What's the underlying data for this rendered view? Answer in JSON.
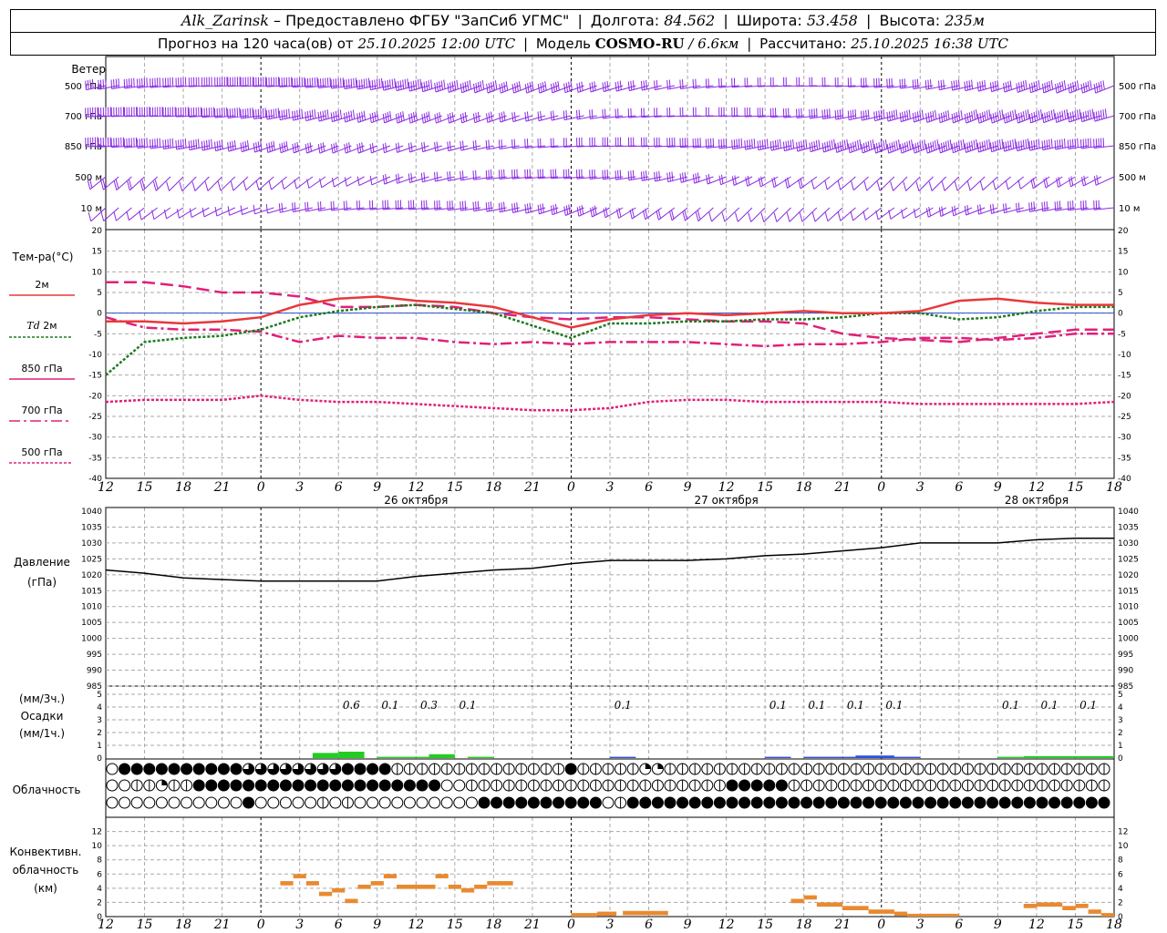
{
  "header": {
    "station": "Alk_Zarinsk",
    "dash": "–",
    "provider": "Предоставлено ФГБУ \"ЗапСиб УГМС\"",
    "lon_label": "Долгота:",
    "lon_value": "84.562",
    "lat_label": "Широта:",
    "lat_value": "53.458",
    "alt_label": "Высота:",
    "alt_value": "235м",
    "forecast_label": "Прогноз на 120 часа(ов) от",
    "forecast_from": "25.10.2025 12:00 UTC",
    "model_label": "Модель",
    "model_name": "COSMO-RU",
    "model_res": "/ 6.6км",
    "calc_label": "Рассчитано:",
    "calc_time": "25.10.2025 16:38 UTC"
  },
  "labels": {
    "wind": "Ветер",
    "temp": "Тем-ра(°C)",
    "t2m": "2м",
    "td": "Td",
    "td2m": "2м",
    "t850": "850 гПа",
    "t700": "700 гПа",
    "t500": "500 гПа",
    "pressure": "Давление",
    "pressure_unit": "(гПа)",
    "precip_unit3": "(мм/3ч.)",
    "precip": "Осадки",
    "precip_unit1": "(мм/1ч.)",
    "cloud": "Облачность",
    "conv1": "Конвективн.",
    "conv2": "облачность",
    "conv3": "(км)"
  },
  "chart_data": {
    "hours": [
      "12",
      "15",
      "18",
      "21",
      "0",
      "3",
      "6",
      "9",
      "12",
      "15",
      "18",
      "21",
      "0",
      "3",
      "6",
      "9",
      "12",
      "15",
      "18",
      "21",
      "0",
      "3",
      "6",
      "9",
      "12",
      "15",
      "18"
    ],
    "dates": [
      "26 октября",
      "27 октября",
      "28 октября"
    ],
    "colors": {
      "t2m": "#e8383a",
      "td": "#1f7a1f",
      "t850": "#e0207a",
      "pressure": "#000000",
      "precip": "#22cc22",
      "precip_blue": "#3050dd",
      "conv": "#e88a30",
      "wind": "#8a2be2",
      "grid": "#aaaaaa"
    },
    "wind": {
      "levels": [
        "500 гПа",
        "700 гПа",
        "850 гПа",
        "500 м",
        "10  м"
      ]
    },
    "temperature": {
      "type": "line",
      "ylim": [
        -40,
        20
      ],
      "yticks": [
        20,
        15,
        10,
        5,
        0,
        -5,
        -10,
        -15,
        -20,
        -25,
        -30,
        -35,
        -40
      ],
      "t2m": [
        -2,
        -2,
        -2.5,
        -2,
        -1,
        2,
        3.5,
        4,
        3,
        2.5,
        1.5,
        -1,
        -3.5,
        -1.5,
        -0.5,
        0,
        -0.5,
        0,
        0.5,
        0,
        0,
        0.5,
        3,
        3.5,
        2.5,
        2,
        2
      ],
      "td2m": [
        -15,
        -7,
        -6,
        -5.5,
        -4,
        -1,
        0.5,
        1.5,
        2,
        1,
        0,
        -3,
        -6,
        -2.5,
        -2.5,
        -2,
        -2,
        -1.5,
        -1.5,
        -1,
        0,
        0,
        -1.5,
        -1,
        0.5,
        1.5,
        1.5
      ],
      "t850": [
        7.5,
        7.5,
        6.5,
        5,
        5,
        4,
        1.5,
        1.5,
        2,
        1.5,
        0,
        -1,
        -1.5,
        -1,
        -1,
        -1.5,
        -2,
        -2,
        -2.5,
        -5,
        -6,
        -6.5,
        -7,
        -6,
        -5,
        -4,
        -4
      ],
      "t700": [
        -1,
        -3.5,
        -4,
        -4,
        -4.5,
        -7,
        -5.5,
        -6,
        -6,
        -7,
        -7.5,
        -7,
        -7.5,
        -7,
        -7,
        -7,
        -7.5,
        -8,
        -7.5,
        -7.5,
        -7,
        -6,
        -6,
        -6.5,
        -6,
        -5,
        -5
      ],
      "t500": [
        -21.5,
        -21,
        -21,
        -21,
        -20,
        -21,
        -21.5,
        -21.5,
        -22,
        -22.5,
        -23,
        -23.5,
        -23.5,
        -23,
        -21.5,
        -21,
        -21,
        -21.5,
        -21.5,
        -21.5,
        -21.5,
        -22,
        -22,
        -22,
        -22,
        -22,
        -21.5
      ]
    },
    "pressure": {
      "type": "line",
      "ylim": [
        985,
        1040
      ],
      "yticks": [
        1040,
        1035,
        1030,
        1025,
        1020,
        1015,
        1010,
        1005,
        1000,
        995,
        990,
        985
      ],
      "values": [
        1021.5,
        1020.5,
        1019,
        1018.5,
        1018,
        1018,
        1018,
        1018,
        1019.5,
        1020.5,
        1021.5,
        1022,
        1023.5,
        1024.5,
        1024.5,
        1024.5,
        1025,
        1026,
        1026.5,
        1027.5,
        1028.5,
        1030,
        1030,
        1030,
        1031,
        1031.5,
        1031.5
      ]
    },
    "precipitation": {
      "type": "bar",
      "ylim": [
        0,
        5
      ],
      "yticks": [
        5,
        4,
        3,
        2,
        1,
        0
      ],
      "labels": [
        {
          "hour": 19,
          "text": "0.6"
        },
        {
          "hour": 22,
          "text": "0.1"
        },
        {
          "hour": 25,
          "text": "0.3"
        },
        {
          "hour": 28,
          "text": "0.1"
        },
        {
          "hour": 40,
          "text": "0.1"
        },
        {
          "hour": 52,
          "text": "0.1"
        },
        {
          "hour": 55,
          "text": "0.1"
        },
        {
          "hour": 58,
          "text": "0.1"
        },
        {
          "hour": 61,
          "text": "0.1"
        },
        {
          "hour": 70,
          "text": "0.1"
        },
        {
          "hour": 73,
          "text": "0.1"
        },
        {
          "hour": 76,
          "text": "0.1"
        }
      ],
      "bars": [
        {
          "h0": 16,
          "h1": 18,
          "v": 0.4,
          "c": "precip"
        },
        {
          "h0": 18,
          "h1": 20,
          "v": 0.5,
          "c": "precip"
        },
        {
          "h0": 21,
          "h1": 25,
          "v": 0.1,
          "c": "precip"
        },
        {
          "h0": 25,
          "h1": 27,
          "v": 0.3,
          "c": "precip"
        },
        {
          "h0": 28,
          "h1": 30,
          "v": 0.1,
          "c": "precip"
        },
        {
          "h0": 39,
          "h1": 41,
          "v": 0.1,
          "c": "precip_blue"
        },
        {
          "h0": 51,
          "h1": 53,
          "v": 0.1,
          "c": "precip_blue"
        },
        {
          "h0": 54,
          "h1": 58,
          "v": 0.1,
          "c": "precip_blue"
        },
        {
          "h0": 58,
          "h1": 61,
          "v": 0.2,
          "c": "precip_blue"
        },
        {
          "h0": 61,
          "h1": 63,
          "v": 0.1,
          "c": "precip_blue"
        },
        {
          "h0": 69,
          "h1": 71,
          "v": 0.1,
          "c": "precip"
        },
        {
          "h0": 71,
          "h1": 75,
          "v": 0.15,
          "c": "precip"
        },
        {
          "h0": 75,
          "h1": 78,
          "v": 0.15,
          "c": "precip"
        }
      ]
    },
    "cloudiness": {
      "type": "table",
      "rows": [
        "011111111114444444411112222222222222212222233222222222222222222222222222222222222",
        "002232211111111111111111111002222222222222222222221111122222222222222222222222222",
        "000000000001000002020000000000111111111102111111111111111111111111111111111111111"
      ]
    },
    "convective": {
      "type": "bar",
      "ylim": [
        0,
        14
      ],
      "yticks": [
        12,
        10,
        8,
        6,
        4,
        2,
        0
      ],
      "bars": [
        {
          "h0": 13.5,
          "h1": 14.5,
          "v": 5
        },
        {
          "h0": 14.5,
          "h1": 15.5,
          "v": 6
        },
        {
          "h0": 15.5,
          "h1": 16.5,
          "v": 5
        },
        {
          "h0": 16.5,
          "h1": 17.5,
          "v": 3.5
        },
        {
          "h0": 17.5,
          "h1": 18.5,
          "v": 4
        },
        {
          "h0": 18.5,
          "h1": 19.5,
          "v": 2.5
        },
        {
          "h0": 19.5,
          "h1": 20.5,
          "v": 4.5
        },
        {
          "h0": 20.5,
          "h1": 21.5,
          "v": 5
        },
        {
          "h0": 21.5,
          "h1": 22.5,
          "v": 6
        },
        {
          "h0": 22.5,
          "h1": 25.5,
          "v": 4.5
        },
        {
          "h0": 25.5,
          "h1": 26.5,
          "v": 6
        },
        {
          "h0": 26.5,
          "h1": 27.5,
          "v": 4.5
        },
        {
          "h0": 27.5,
          "h1": 28.5,
          "v": 4
        },
        {
          "h0": 28.5,
          "h1": 29.5,
          "v": 4.5
        },
        {
          "h0": 29.5,
          "h1": 31.5,
          "v": 5
        },
        {
          "h0": 36,
          "h1": 38,
          "v": 0.5
        },
        {
          "h0": 38,
          "h1": 39.5,
          "v": 0.7
        },
        {
          "h0": 40,
          "h1": 43.5,
          "v": 0.8
        },
        {
          "h0": 53,
          "h1": 54,
          "v": 2.5
        },
        {
          "h0": 54,
          "h1": 55,
          "v": 3
        },
        {
          "h0": 55,
          "h1": 57,
          "v": 2
        },
        {
          "h0": 57,
          "h1": 59,
          "v": 1.5
        },
        {
          "h0": 59,
          "h1": 61,
          "v": 1
        },
        {
          "h0": 61,
          "h1": 62,
          "v": 0.7
        },
        {
          "h0": 62,
          "h1": 66,
          "v": 0.4
        },
        {
          "h0": 71,
          "h1": 72,
          "v": 1.8
        },
        {
          "h0": 72,
          "h1": 74,
          "v": 2
        },
        {
          "h0": 74,
          "h1": 75,
          "v": 1.5
        },
        {
          "h0": 75,
          "h1": 76,
          "v": 1.8
        },
        {
          "h0": 76,
          "h1": 77,
          "v": 1
        },
        {
          "h0": 77,
          "h1": 78,
          "v": 0.5
        }
      ]
    }
  }
}
